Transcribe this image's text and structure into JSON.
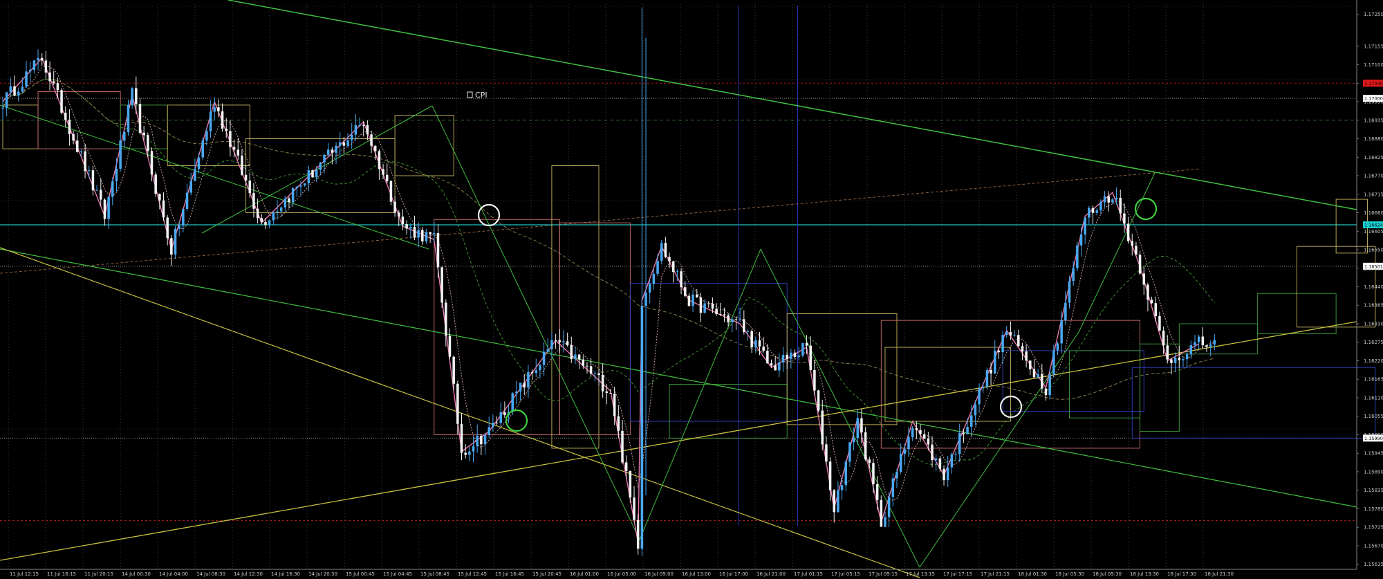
{
  "chart_data": {
    "type": "candlestick",
    "instrument": "EURUSD",
    "timeframe": "M15",
    "ylim": [
      1.156,
      1.1728
    ],
    "y_ticks": [
      "1.17250",
      "1.17155",
      "1.17100",
      "1.17045",
      "1.16990",
      "1.16935",
      "1.16880",
      "1.16825",
      "1.16770",
      "1.16715",
      "1.16660",
      "1.16605",
      "1.16550",
      "1.16495",
      "1.16440",
      "1.16385",
      "1.16330",
      "1.16275",
      "1.16220",
      "1.16165",
      "1.16110",
      "1.16055",
      "1.16000",
      "1.15945",
      "1.15890",
      "1.15835",
      "1.15780",
      "1.15725",
      "1.15670",
      "1.15615"
    ],
    "x_ticks": [
      "11 Jul 12:15",
      "11 Jul 16:15",
      "11 Jul 20:15",
      "14 Jul 00:30",
      "14 Jul 04:00",
      "14 Jul 08:30",
      "14 Jul 12:30",
      "14 Jul 16:30",
      "14 Jul 20:30",
      "15 Jul 00:45",
      "15 Jul 04:45",
      "15 Jul 08:45",
      "15 Jul 12:45",
      "15 Jul 16:45",
      "15 Jul 20:45",
      "16 Jul 01:00",
      "16 Jul 05:00",
      "16 Jul 09:00",
      "16 Jul 13:00",
      "16 Jul 17:00",
      "16 Jul 21:00",
      "17 Jul 01:15",
      "17 Jul 05:15",
      "17 Jul 09:15",
      "17 Jul 13:15",
      "17 Jul 17:15",
      "17 Jul 21:15",
      "18 Jul 01:30",
      "18 Jul 05:30",
      "18 Jul 09:30",
      "18 Jul 13:30",
      "18 Jul 17:30",
      "18 Jul 21:30"
    ],
    "price_tags": [
      {
        "value": "1.17045",
        "color": "#e01818"
      },
      {
        "value": "1.17000",
        "color": "#ffffff"
      },
      {
        "value": "1.16624",
        "color": "#18d0d0"
      },
      {
        "value": "1.16501",
        "color": "#ffffff"
      },
      {
        "value": "1.15990",
        "color": "#ffffff"
      }
    ],
    "pivots": [
      [
        0,
        1.1699
      ],
      [
        10,
        1.1712
      ],
      [
        26,
        1.1665
      ],
      [
        33,
        1.1701
      ],
      [
        43,
        1.1655
      ],
      [
        54,
        1.1699
      ],
      [
        66,
        1.1663
      ],
      [
        92,
        1.1693
      ],
      [
        102,
        1.1662
      ],
      [
        110,
        1.1658
      ],
      [
        117,
        1.1595
      ],
      [
        124,
        1.1601
      ],
      [
        141,
        1.1628
      ],
      [
        155,
        1.1613
      ],
      [
        162,
        1.1568
      ],
      [
        163,
        1.164
      ],
      [
        168,
        1.1656
      ],
      [
        175,
        1.164
      ],
      [
        188,
        1.1633
      ],
      [
        196,
        1.162
      ],
      [
        205,
        1.1626
      ],
      [
        212,
        1.1578
      ],
      [
        218,
        1.1605
      ],
      [
        224,
        1.1574
      ],
      [
        232,
        1.1604
      ],
      [
        240,
        1.1588
      ],
      [
        250,
        1.1615
      ],
      [
        256,
        1.1631
      ],
      [
        266,
        1.1614
      ],
      [
        276,
        1.1665
      ],
      [
        283,
        1.1672
      ],
      [
        290,
        1.165
      ],
      [
        297,
        1.1622
      ],
      [
        305,
        1.1627
      ]
    ],
    "annotations": [
      {
        "text": "CPI"
      }
    ]
  }
}
